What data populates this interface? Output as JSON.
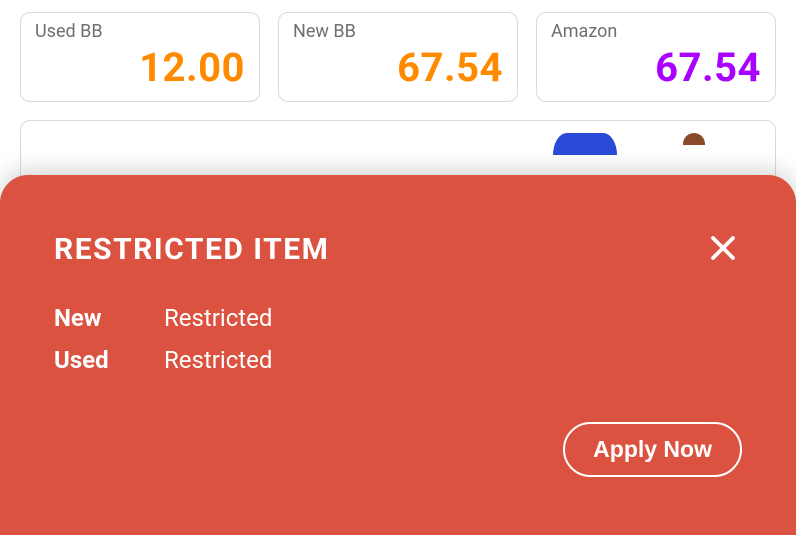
{
  "cards": [
    {
      "label": "Used BB",
      "value": "12.00",
      "colorClass": "orange"
    },
    {
      "label": "New BB",
      "value": "67.54",
      "colorClass": "orange"
    },
    {
      "label": "Amazon",
      "value": "67.54",
      "colorClass": "purple"
    }
  ],
  "modal": {
    "title": "RESTRICTED ITEM",
    "rows": {
      "new": {
        "key": "New",
        "value": "Restricted"
      },
      "used": {
        "key": "Used",
        "value": "Restricted"
      }
    },
    "applyLabel": "Apply Now"
  }
}
